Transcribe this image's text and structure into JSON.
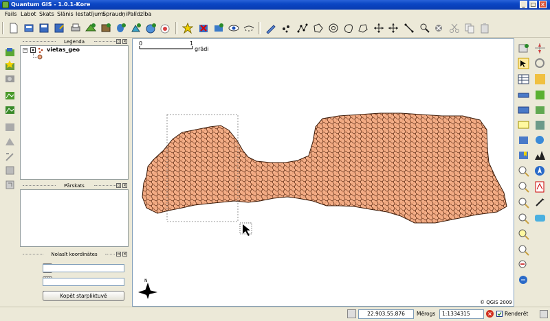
{
  "window": {
    "title": "Quantum GIS - 1.0.1-Kore"
  },
  "menu": [
    "Fails",
    "Labot",
    "Skats",
    "Slānis",
    "Iestatījumi",
    "Spraudņi",
    "Palīdzība"
  ],
  "toolbar_icons": [
    "new-project-icon",
    "open-project-icon",
    "save-project-icon",
    "save-as-icon",
    "print-icon",
    "add-vector-layer-icon",
    "add-raster-layer-icon",
    "add-postgis-layer-icon",
    "new-vector-layer-icon",
    "add-wms-layer-icon",
    "add-wfs-layer-icon",
    "show-all-layers-icon",
    "remove-layer-icon",
    "overview-add-icon",
    "show-hide-icon",
    "hide-all-icon",
    "edit-pencil-icon",
    "capture-point-icon",
    "capture-line-icon",
    "capture-polygon-icon",
    "ring-icon",
    "island-icon",
    "move-feature-icon",
    "add-vertex-icon",
    "move-vertex-icon",
    "delete-vertex-icon",
    "split-icon",
    "delete-selected-icon",
    "cut-icon",
    "copy-icon",
    "paste-icon"
  ],
  "legend": {
    "title": "Leģenda",
    "layer_name": "vietas_geo"
  },
  "overview": {
    "title": "Pārskats"
  },
  "coord_panel": {
    "title": "Nolasīt koordinātes",
    "copy_button": "Kopēt starpliktuvē",
    "field1": "",
    "field2": ""
  },
  "scale_bar": {
    "start": "0",
    "end": "1",
    "unit": "grādi"
  },
  "north_arrow": "N",
  "copyright": "© QGIS 2009",
  "status": {
    "coordinates": "22.903,55.876",
    "scale_label": "Mērogs",
    "scale_value": "1:1334315",
    "render_label": "Renderēt"
  },
  "colors": {
    "point_fill": "#f2a880",
    "point_stroke": "#5a2a12",
    "titlebar": "#0b46c4"
  }
}
